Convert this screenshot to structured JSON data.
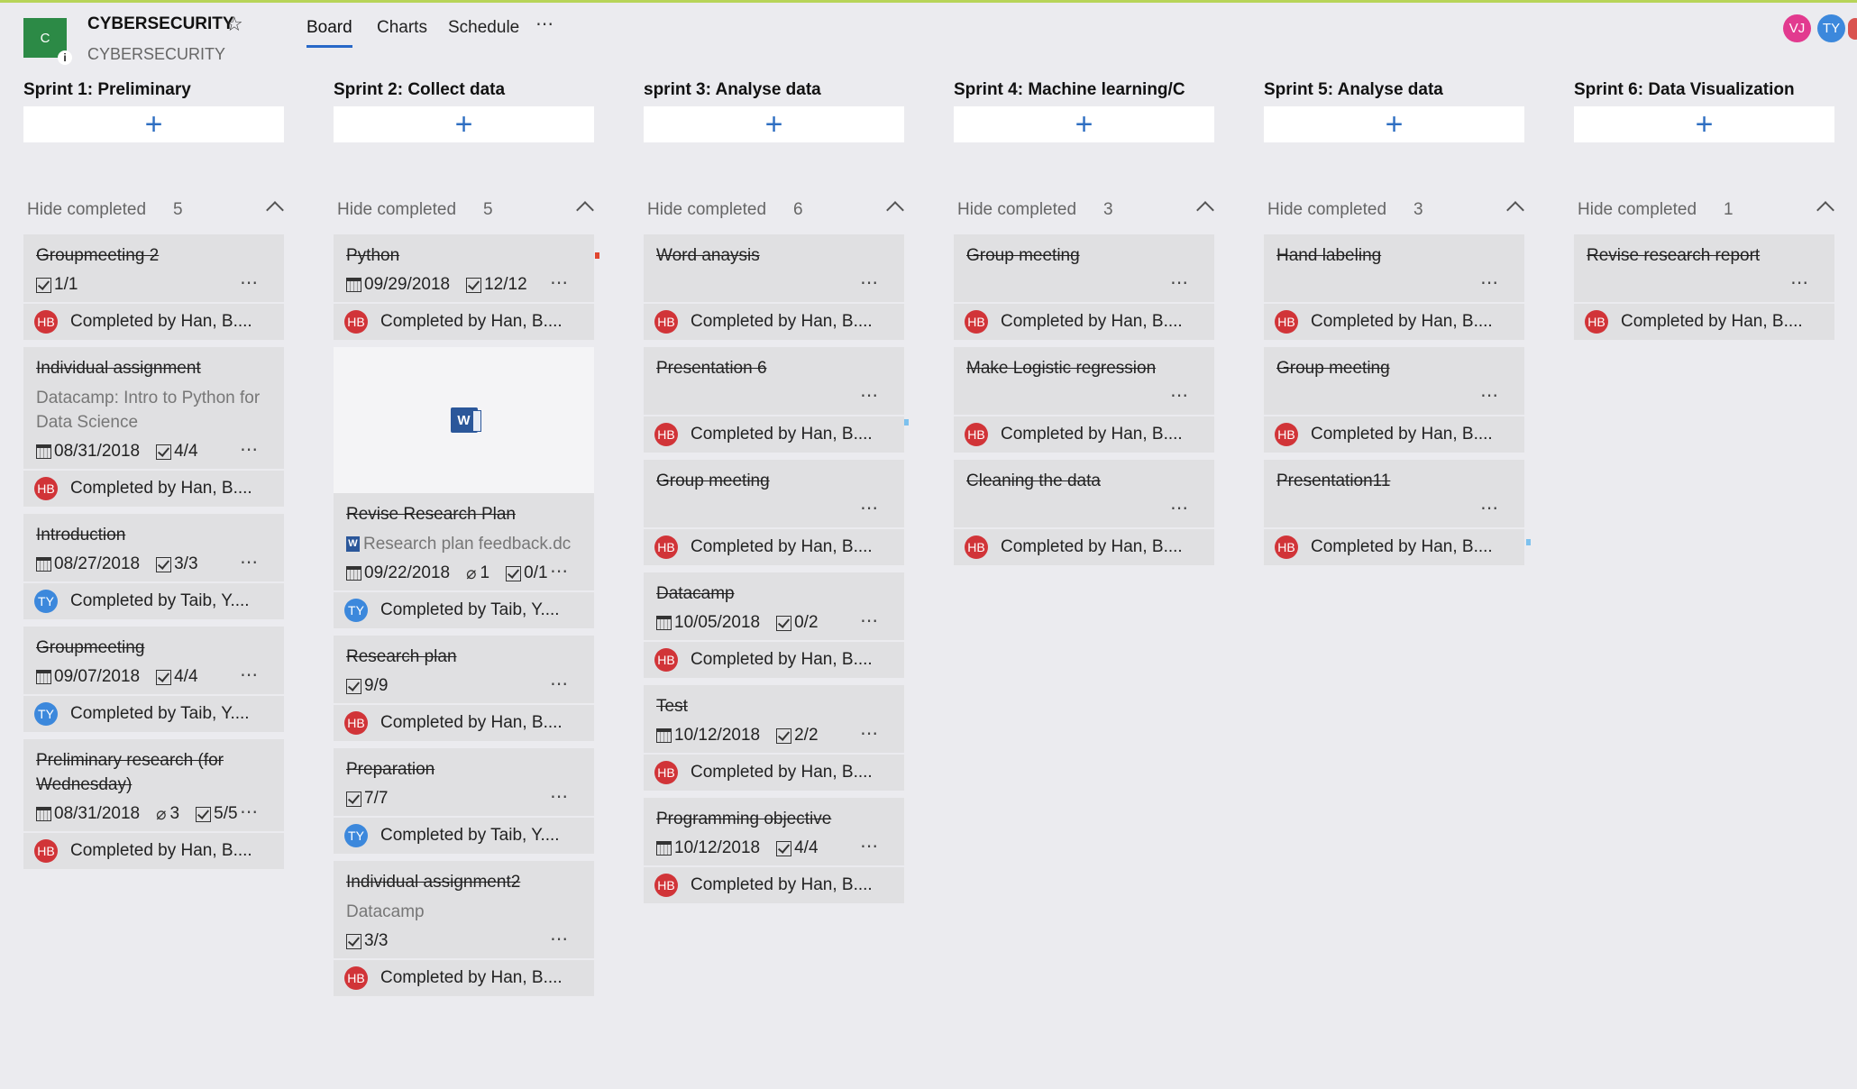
{
  "header": {
    "logo_letter": "C",
    "logo_info": "i",
    "title": "CYBERSECURITY",
    "subtitle": "CYBERSECURITY",
    "star_icon": "☆",
    "tabs": {
      "board": "Board",
      "charts": "Charts",
      "schedule": "Schedule"
    },
    "more_icon": "⋯",
    "members": [
      "VJ",
      "TY"
    ]
  },
  "board": {
    "add_icon": "+",
    "card_more_icon": "⋯",
    "hide_completed_label": "Hide completed",
    "columns": [
      {
        "title": "Sprint 1: Preliminary",
        "completed_count": "5",
        "cards": [
          {
            "title": "Groupmeeting 2",
            "checklist": "1/1",
            "completed_by": "Completed by Han, B....",
            "avatar": "HB"
          },
          {
            "title": "Individual assignment",
            "note": "Datacamp: Intro to Python for Data Science",
            "due": "08/31/2018",
            "checklist": "4/4",
            "completed_by": "Completed by Han, B....",
            "avatar": "HB"
          },
          {
            "title": "Introduction",
            "due": "08/27/2018",
            "checklist": "3/3",
            "completed_by": "Completed by Taib, Y....",
            "avatar": "TY"
          },
          {
            "title": "Groupmeeting",
            "due": "09/07/2018",
            "checklist": "4/4",
            "completed_by": "Completed by Taib, Y....",
            "avatar": "TY"
          },
          {
            "title": "Preliminary research (for Wednesday)",
            "due": "08/31/2018",
            "attachments": "3",
            "checklist": "5/5",
            "completed_by": "Completed by Han, B....",
            "avatar": "HB"
          }
        ]
      },
      {
        "title": "Sprint 2: Collect data",
        "completed_count": "5",
        "cards": [
          {
            "title": "Python",
            "due": "09/29/2018",
            "checklist": "12/12",
            "completed_by": "Completed by Han, B....",
            "avatar": "HB"
          },
          {
            "title": "Revise Research Plan",
            "file": "Research plan feedback.dc",
            "due": "09/22/2018",
            "attachments": "1",
            "checklist": "0/1",
            "completed_by": "Completed by Taib, Y....",
            "avatar": "TY"
          },
          {
            "title": "Research plan",
            "checklist": "9/9",
            "completed_by": "Completed by Han, B....",
            "avatar": "HB"
          },
          {
            "title": "Preparation",
            "checklist": "7/7",
            "completed_by": "Completed by Taib, Y....",
            "avatar": "TY"
          },
          {
            "title": "Individual assignment2",
            "note": "Datacamp",
            "checklist": "3/3",
            "completed_by": "Completed by Han, B....",
            "avatar": "HB"
          }
        ]
      },
      {
        "title": "sprint 3: Analyse data",
        "completed_count": "6",
        "cards": [
          {
            "title": "Word anaysis",
            "completed_by": "Completed by Han, B....",
            "avatar": "HB"
          },
          {
            "title": "Presentation 6",
            "completed_by": "Completed by Han, B....",
            "avatar": "HB"
          },
          {
            "title": "Group meeting",
            "completed_by": "Completed by Han, B....",
            "avatar": "HB"
          },
          {
            "title": "Datacamp",
            "due": "10/05/2018",
            "checklist": "0/2",
            "completed_by": "Completed by Han, B....",
            "avatar": "HB"
          },
          {
            "title": "Test",
            "due": "10/12/2018",
            "checklist": "2/2",
            "completed_by": "Completed by Han, B....",
            "avatar": "HB"
          },
          {
            "title": "Programming objective",
            "due": "10/12/2018",
            "checklist": "4/4",
            "completed_by": "Completed by Han, B....",
            "avatar": "HB"
          }
        ]
      },
      {
        "title": "Sprint 4: Machine learning/C",
        "completed_count": "3",
        "cards": [
          {
            "title": "Group meeting",
            "completed_by": "Completed by Han, B....",
            "avatar": "HB"
          },
          {
            "title": "Make Logistic regression",
            "completed_by": "Completed by Han, B....",
            "avatar": "HB"
          },
          {
            "title": "Cleaning the data",
            "completed_by": "Completed by Han, B....",
            "avatar": "HB"
          }
        ]
      },
      {
        "title": "Sprint 5: Analyse data",
        "completed_count": "3",
        "cards": [
          {
            "title": "Hand labeling",
            "completed_by": "Completed by Han, B....",
            "avatar": "HB"
          },
          {
            "title": "Group meeting",
            "completed_by": "Completed by Han, B....",
            "avatar": "HB"
          },
          {
            "title": "Presentation11",
            "completed_by": "Completed by Han, B....",
            "avatar": "HB"
          }
        ]
      },
      {
        "title": "Sprint 6: Data Visualization",
        "completed_count": "1",
        "cards": [
          {
            "title": "Revise research report",
            "completed_by": "Completed by Han, B....",
            "avatar": "HB"
          }
        ]
      }
    ]
  },
  "colors": {
    "accent": "#2f6fc2",
    "logo": "#2c8a46",
    "avatar_hb": "#d13438",
    "avatar_ty": "#3c88dc",
    "avatar_vj": "#e23a8f"
  }
}
